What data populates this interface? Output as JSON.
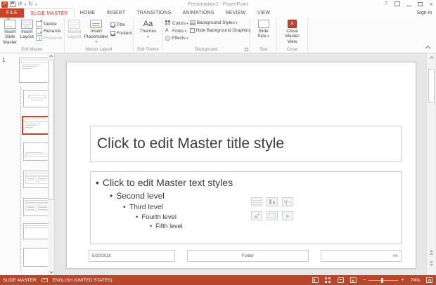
{
  "titlebar": {
    "title": "Presentation1 - PowerPoint",
    "sign_in": "Sign in"
  },
  "tabs": {
    "file": "FILE",
    "items": [
      "SLIDE MASTER",
      "HOME",
      "INSERT",
      "TRANSITIONS",
      "ANIMATIONS",
      "REVIEW",
      "VIEW"
    ],
    "active": "SLIDE MASTER"
  },
  "ribbon": {
    "edit_master": {
      "label": "Edit Master",
      "insert_slide_master": "Insert Slide Master",
      "insert_layout": "Insert Layout",
      "delete": "Delete",
      "rename": "Rename",
      "preserve": "Preserve"
    },
    "master_layout": {
      "label": "Master Layout",
      "master_layout": "Master Layout",
      "insert_placeholder": "Insert Placeholder",
      "title": "Title",
      "footers": "Footers"
    },
    "edit_theme": {
      "label": "Edit Theme",
      "themes": "Themes"
    },
    "background": {
      "label": "Background",
      "colors": "Colors",
      "fonts": "Fonts",
      "effects": "Effects",
      "background_styles": "Background Styles",
      "hide_background_graphics": "Hide Background Graphics"
    },
    "size": {
      "label": "Size",
      "slide_size": "Slide Size"
    },
    "close": {
      "label": "Close",
      "close_master_view": "Close Master View"
    }
  },
  "thumbnails": {
    "master_number": "1"
  },
  "slide": {
    "title_placeholder": "Click to edit Master title style",
    "bullets": [
      "Click to edit Master text styles",
      "Second level",
      "Third level",
      "Fourth level",
      "Fifth level"
    ],
    "date": "5/20/2016",
    "footer": "Footer",
    "slide_number": "‹#›"
  },
  "statusbar": {
    "view_name": "SLIDE MASTER",
    "language": "ENGLISH (UNITED STATES)",
    "zoom_level": "74%"
  },
  "colors": {
    "accent": "#B7472A",
    "file_tab": "#C8432C",
    "selection_border": "#C8432C"
  }
}
